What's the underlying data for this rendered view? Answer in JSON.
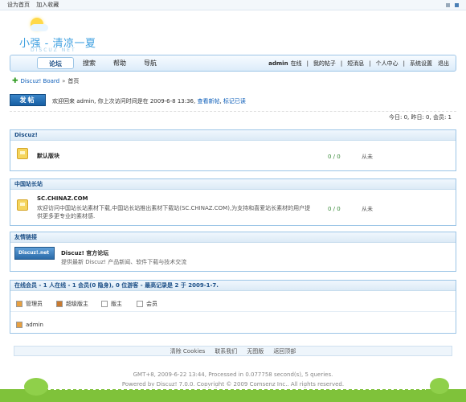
{
  "topbar": {
    "set_home": "设为首页",
    "bookmark": "加入收藏"
  },
  "logo": {
    "title": "小强 - 清凉一夏",
    "subtitle": "DISCUZ NET"
  },
  "nav": {
    "tabs": [
      "论坛",
      "搜索",
      "帮助",
      "导航"
    ],
    "user": "admin",
    "online": "在线",
    "right": [
      "我的帖子",
      "短消息",
      "个人中心",
      "系统设置",
      "退出"
    ]
  },
  "breadcrumb": {
    "board": "Discuz! Board",
    "sep": "»",
    "home": "首页"
  },
  "post_button": "发帖",
  "welcome": {
    "text": "欢迎回来 admin, 你上次访问时间是在 2009-6-8 13:36,",
    "link1": "查看新帖",
    "link2": "标记已读"
  },
  "stats": "今日: 0, 昨日: 0, 会员: 1",
  "categories": [
    {
      "title": "Discuz!",
      "forum": "默认版块",
      "desc": "",
      "count": "0 / 0",
      "last": "从未"
    },
    {
      "title": "中国站长站",
      "forum": "SC.CHINAZ.COM",
      "desc": "欢迎访问中国站长站素材下载,中国站长站推出素材下载站(SC.CHINAZ.COM),为支持和喜爱站长素材的用户提供更多更专业的素材感.",
      "count": "0 / 0",
      "last": "从未"
    }
  ],
  "friends": {
    "title": "友情链接",
    "img": "Discuz!.net",
    "name": "Discuz! 官方论坛",
    "desc": "提供最新 Discuz! 产品新闻、软件下载与技术交流"
  },
  "online": {
    "header": "在线会员 - 1 人在线 - 1 会员(0 隐身), 0 位游客 - 最高记录是 2 于 2009-1-7.",
    "legend": [
      "管理员",
      "超级版主",
      "版主",
      "会员"
    ],
    "user": "admin"
  },
  "footer": {
    "links": [
      "清除 Cookies",
      "联系我们",
      "无图版",
      "返回顶部"
    ],
    "gmt": "GMT+8, 2009-6-22 13:44, Processed in 0.077758 second(s), 5 queries.",
    "powered": "Powered by Discuz! 7.0.0, Copyright © 2009 Comsenz Inc., All rights reserved."
  }
}
